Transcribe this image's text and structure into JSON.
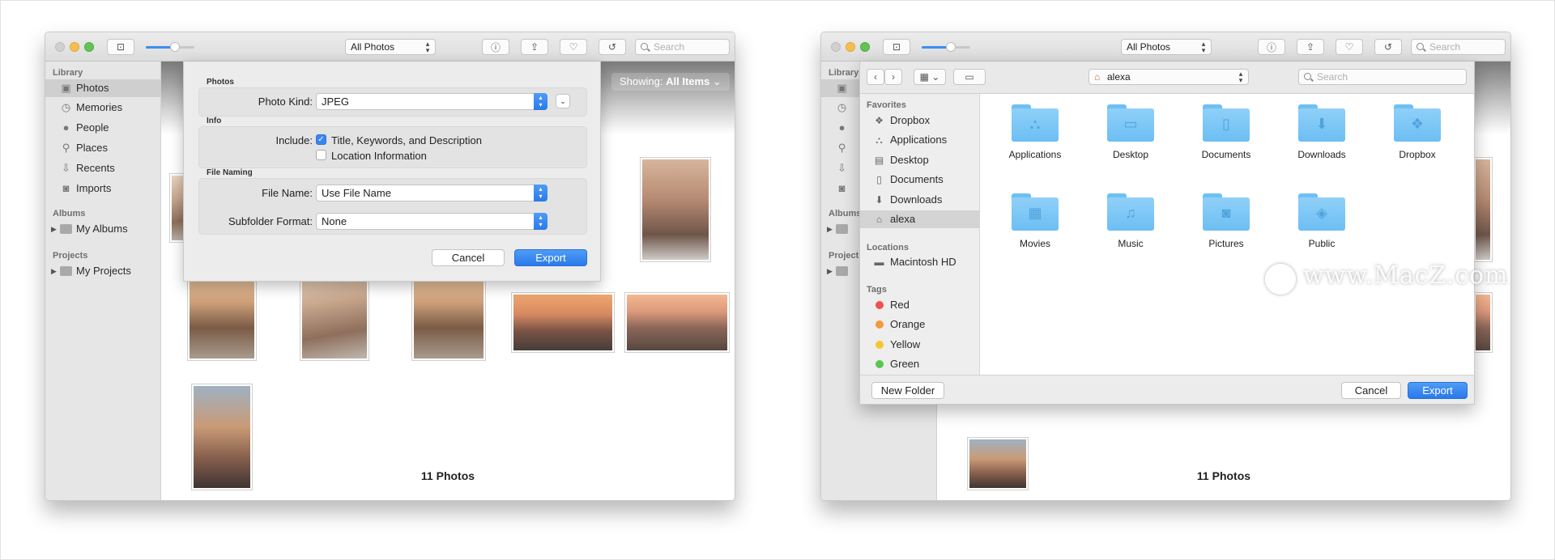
{
  "toolbar": {
    "view_selector": "All Photos",
    "search_placeholder": "Search"
  },
  "sidebar": {
    "library_header": "Library",
    "items": [
      {
        "label": "Photos",
        "icon": "photos-icon",
        "selected": true
      },
      {
        "label": "Memories",
        "icon": "memories-icon"
      },
      {
        "label": "People",
        "icon": "person-icon"
      },
      {
        "label": "Places",
        "icon": "pin-icon"
      },
      {
        "label": "Recents",
        "icon": "recents-icon"
      },
      {
        "label": "Imports",
        "icon": "camera-icon"
      }
    ],
    "albums_header": "Albums",
    "albums_item": "My Albums",
    "projects_header": "Projects",
    "projects_item": "My Projects"
  },
  "content": {
    "showing_prefix": "Showing:",
    "showing_value": "All Items",
    "photo_count": "11 Photos"
  },
  "export_sheet": {
    "photos_section": "Photos",
    "photo_kind_label": "Photo Kind:",
    "photo_kind_value": "JPEG",
    "info_section": "Info",
    "include_label": "Include:",
    "include_title": "Title, Keywords, and Description",
    "include_title_checked": true,
    "include_location": "Location Information",
    "include_location_checked": false,
    "file_naming_section": "File Naming",
    "file_name_label": "File Name:",
    "file_name_value": "Use File Name",
    "subfolder_label": "Subfolder Format:",
    "subfolder_value": "None",
    "cancel": "Cancel",
    "export": "Export"
  },
  "save_dialog": {
    "location": "alexa",
    "search_placeholder": "Search",
    "favorites_header": "Favorites",
    "favorites": [
      {
        "label": "Dropbox",
        "icon": "dropbox-icon"
      },
      {
        "label": "Applications",
        "icon": "applications-icon"
      },
      {
        "label": "Desktop",
        "icon": "desktop-icon"
      },
      {
        "label": "Documents",
        "icon": "documents-icon"
      },
      {
        "label": "Downloads",
        "icon": "downloads-icon"
      },
      {
        "label": "alexa",
        "icon": "home-icon",
        "selected": true
      }
    ],
    "locations_header": "Locations",
    "locations": [
      {
        "label": "Macintosh HD",
        "icon": "disk-icon"
      }
    ],
    "tags_header": "Tags",
    "tags": [
      {
        "label": "Red",
        "color": "#f0524f"
      },
      {
        "label": "Orange",
        "color": "#f39a38"
      },
      {
        "label": "Yellow",
        "color": "#f5c631"
      },
      {
        "label": "Green",
        "color": "#5ac552"
      }
    ],
    "folders": [
      {
        "label": "Applications",
        "glyph": "applications-glyph"
      },
      {
        "label": "Desktop",
        "glyph": "desktop-glyph"
      },
      {
        "label": "Documents",
        "glyph": "documents-glyph"
      },
      {
        "label": "Downloads",
        "glyph": "downloads-glyph"
      },
      {
        "label": "Dropbox",
        "glyph": "dropbox-glyph"
      },
      {
        "label": "Movies",
        "glyph": "movies-glyph"
      },
      {
        "label": "Music",
        "glyph": "music-glyph"
      },
      {
        "label": "Pictures",
        "glyph": "pictures-glyph"
      },
      {
        "label": "Public",
        "glyph": "public-glyph"
      }
    ],
    "new_folder": "New Folder",
    "cancel": "Cancel",
    "export": "Export"
  },
  "watermark": "www.MacZ.com"
}
